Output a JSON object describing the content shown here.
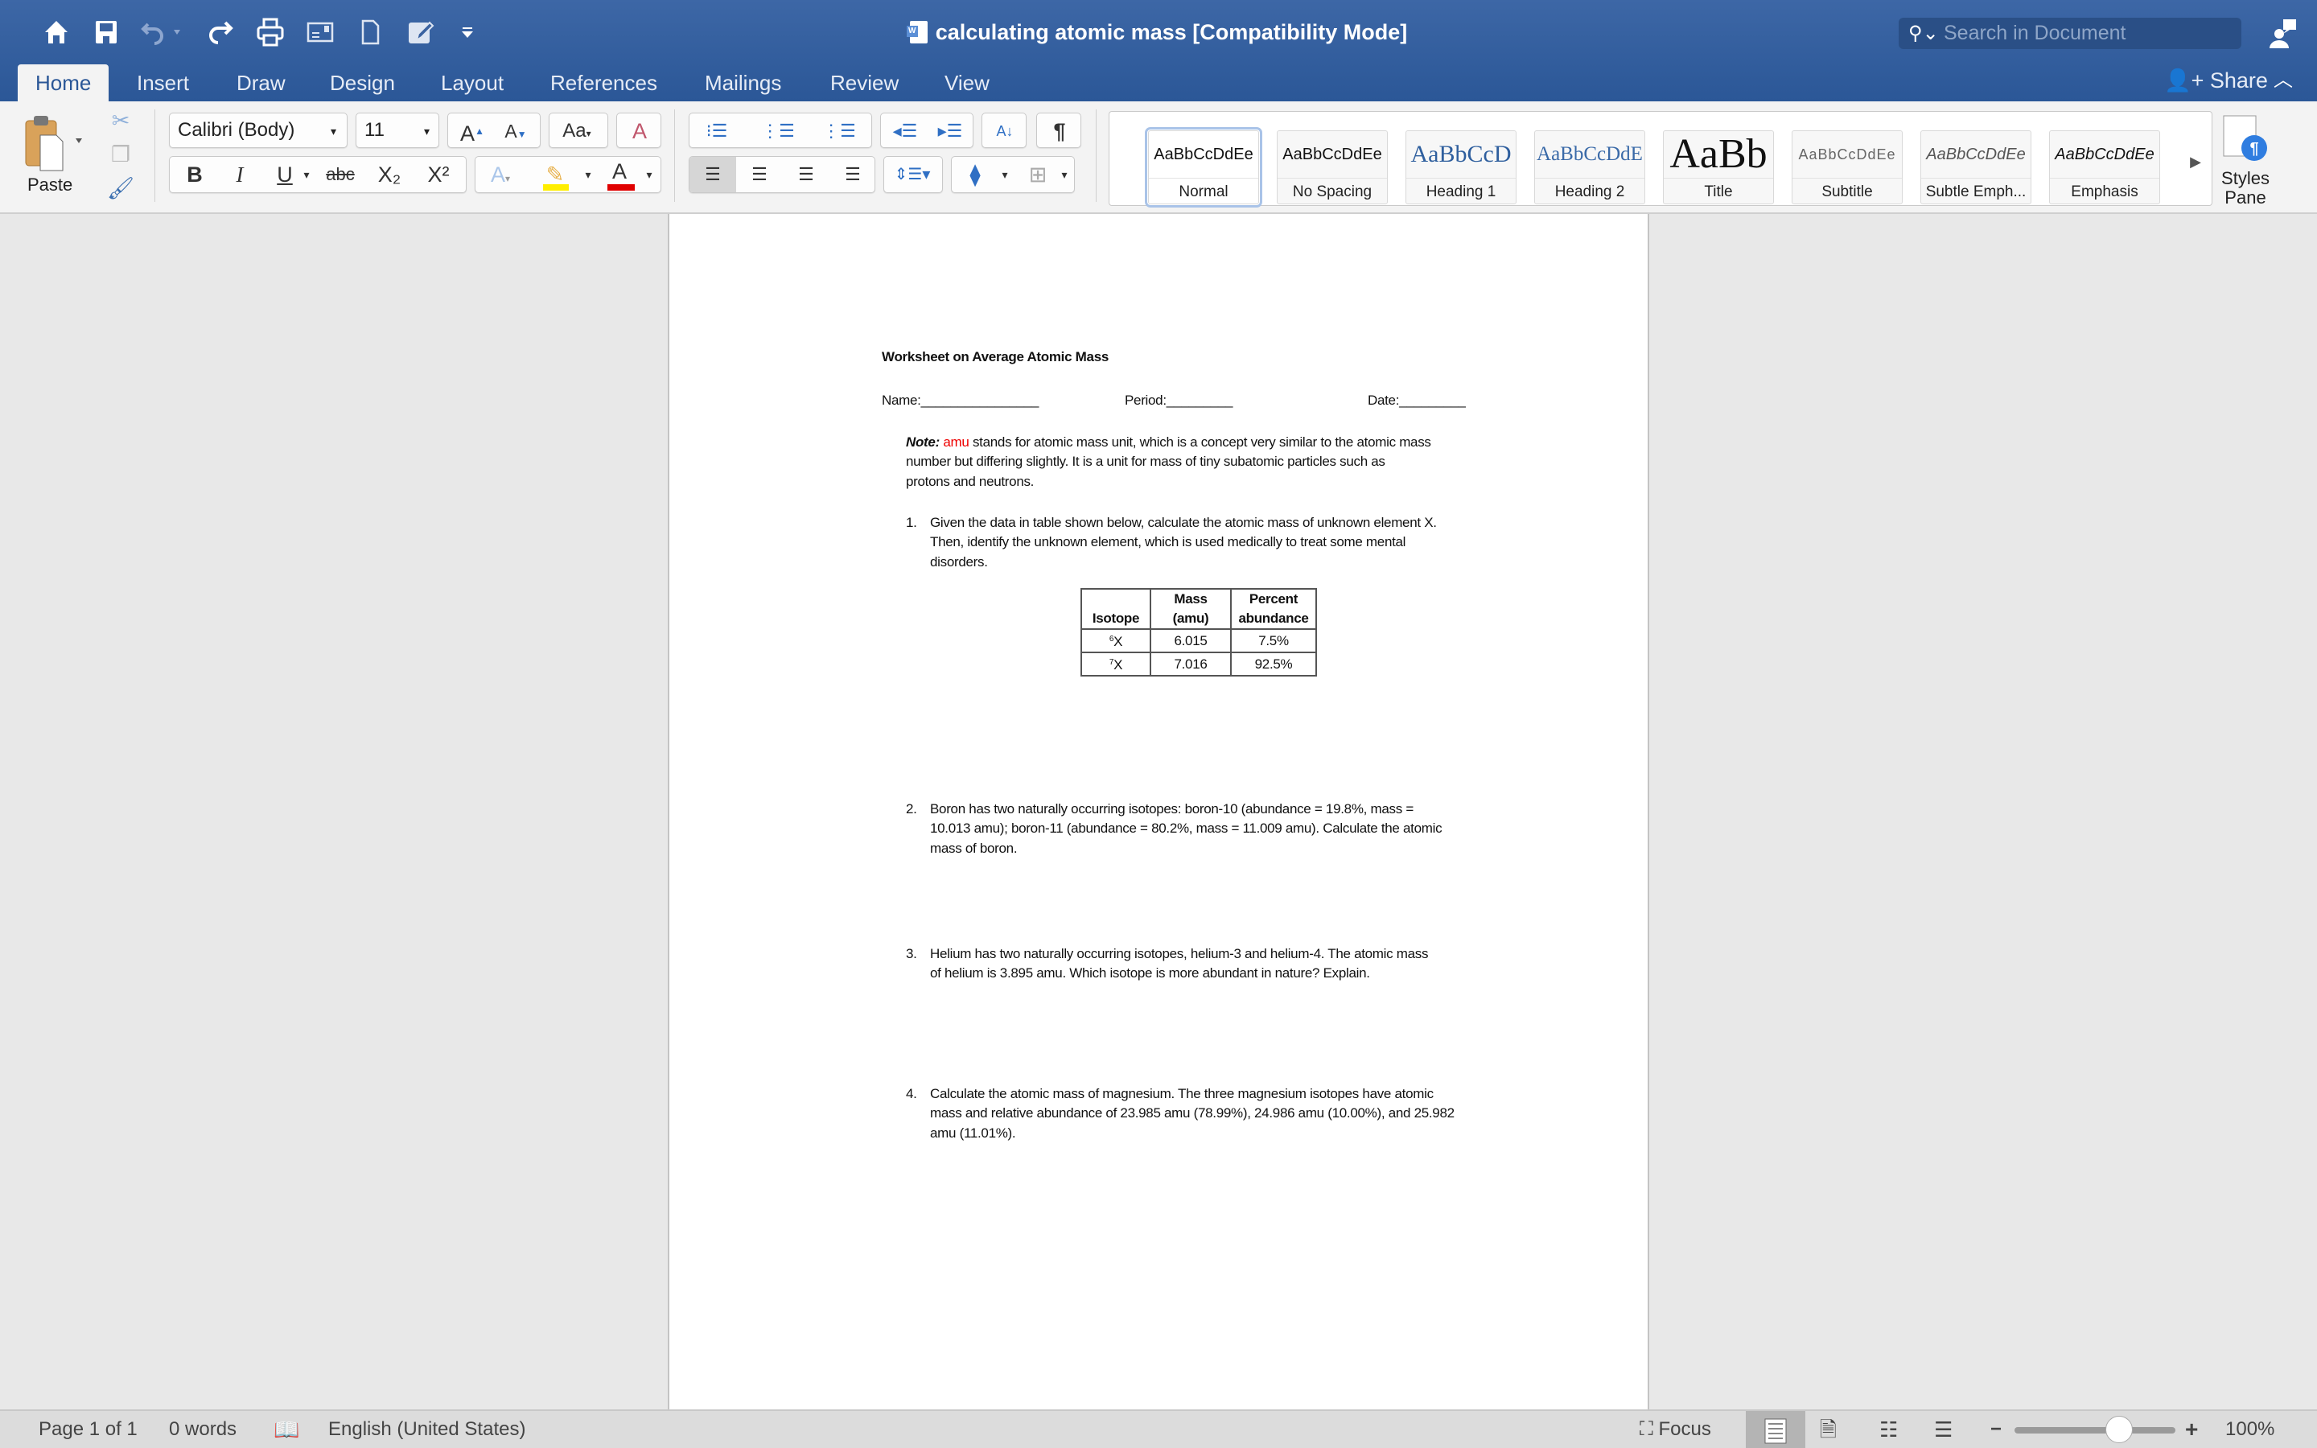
{
  "window": {
    "title": "calculating atomic mass [Compatibility Mode]",
    "search_placeholder": "Search in Document"
  },
  "quick_access": {
    "icons": [
      "home-icon",
      "save-icon",
      "undo-icon",
      "redo-icon",
      "print-icon",
      "envelope-icon",
      "new-document-icon",
      "edit-document-icon",
      "customize-toolbar-icon"
    ]
  },
  "tabs": [
    {
      "label": "Home",
      "active": true
    },
    {
      "label": "Insert"
    },
    {
      "label": "Draw"
    },
    {
      "label": "Design"
    },
    {
      "label": "Layout"
    },
    {
      "label": "References"
    },
    {
      "label": "Mailings"
    },
    {
      "label": "Review"
    },
    {
      "label": "View"
    }
  ],
  "share_label": "Share",
  "ribbon": {
    "paste_label": "Paste",
    "font_name": "Calibri (Body)",
    "font_size": "11",
    "bold": "B",
    "italic": "I",
    "underline": "U",
    "strike": "abc",
    "subscript": "X₂",
    "superscript": "X²",
    "font_color": "#e00000",
    "highlight_color": "#ffee00",
    "styles": [
      {
        "preview": "AaBbCcDdEe",
        "label": "Normal",
        "selected": true
      },
      {
        "preview": "AaBbCcDdEe",
        "label": "No Spacing"
      },
      {
        "preview": "AaBbCcD",
        "label": "Heading 1"
      },
      {
        "preview": "AaBbCcDdE",
        "label": "Heading 2"
      },
      {
        "preview": "AaBb",
        "label": "Title"
      },
      {
        "preview": "AaBbCcDdEe",
        "label": "Subtitle"
      },
      {
        "preview": "AaBbCcDdEe",
        "label": "Subtle Emph..."
      },
      {
        "preview": "AaBbCcDdEe",
        "label": "Emphasis"
      }
    ],
    "styles_pane_label": "Styles Pane"
  },
  "document": {
    "heading": "Worksheet on Average Atomic Mass",
    "name_field": "Name:________________",
    "period_field": "Period:_________",
    "date_field": "Date:_________",
    "note_label": "Note:",
    "note_amu": "amu",
    "note_text_1": " stands for atomic mass unit, which is a concept very similar to the atomic mass",
    "note_text_2": "number but differing slightly.  It is a unit for mass of tiny subatomic particles such as",
    "note_text_3": "protons and neutrons.",
    "questions": [
      {
        "num": "1.",
        "lines": [
          "Given the data in table shown below, calculate the atomic mass of unknown element X.",
          "Then, identify the unknown element, which is used medically to treat some mental",
          "disorders."
        ]
      },
      {
        "num": "2.",
        "lines": [
          "Boron has two naturally occurring isotopes: boron-10 (abundance = 19.8%, mass =",
          "10.013 amu); boron-11 (abundance = 80.2%, mass = 11.009 amu).  Calculate the atomic",
          "mass of boron."
        ]
      },
      {
        "num": "3.",
        "lines": [
          "Helium has two naturally occurring isotopes, helium-3 and helium-4.  The atomic mass",
          "of helium is 3.895 amu.  Which isotope is more abundant in nature?  Explain."
        ]
      },
      {
        "num": "4.",
        "lines": [
          "Calculate the atomic mass of magnesium.  The three magnesium isotopes have atomic",
          "mass and relative abundance of 23.985 amu (78.99%), 24.986 amu (10.00%), and 25.982",
          "amu (11.01%)."
        ]
      }
    ],
    "table": {
      "headers": [
        [
          "",
          "Isotope"
        ],
        [
          "Mass",
          "(amu)"
        ],
        [
          "Percent",
          "abundance"
        ]
      ],
      "rows": [
        {
          "isotope_mass_number": "6",
          "isotope_symbol": "X",
          "mass": "6.015",
          "abundance": "7.5%"
        },
        {
          "isotope_mass_number": "7",
          "isotope_symbol": "X",
          "mass": "7.016",
          "abundance": "92.5%"
        }
      ]
    }
  },
  "status": {
    "page": "Page 1 of 1",
    "words": "0 words",
    "language": "English (United States)",
    "focus_label": "Focus",
    "zoom": "100%",
    "zoom_percent": 100
  }
}
